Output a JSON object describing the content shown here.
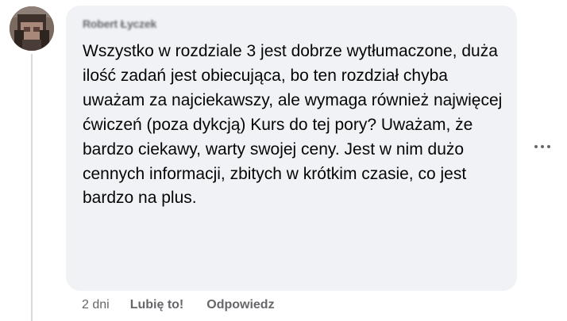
{
  "comment": {
    "author": "Robert Łyczek",
    "text": "Wszystko w rozdziale 3 jest dobrze wytłumaczone, duża ilość zadań jest obiecująca, bo ten rozdział chyba uważam za najciekawszy, ale wymaga również najwięcej ćwiczeń (poza dykcją) Kurs do tej pory? Uważam, że bardzo ciekawy, warty swojej ceny. Jest w nim dużo cennych informacji, zbitych w krótkim czasie, co jest bardzo na plus.",
    "timestamp": "2 dni",
    "like_label": "Lubię to!",
    "reply_label": "Odpowiedz"
  },
  "icons": {
    "avatar": "avatar-blurred-photo",
    "more": "more-options-icon"
  },
  "colors": {
    "bubble_background": "#f0f2f5",
    "text": "#050505",
    "secondary_text": "#65676b",
    "thread_line": "#d8dadf"
  }
}
